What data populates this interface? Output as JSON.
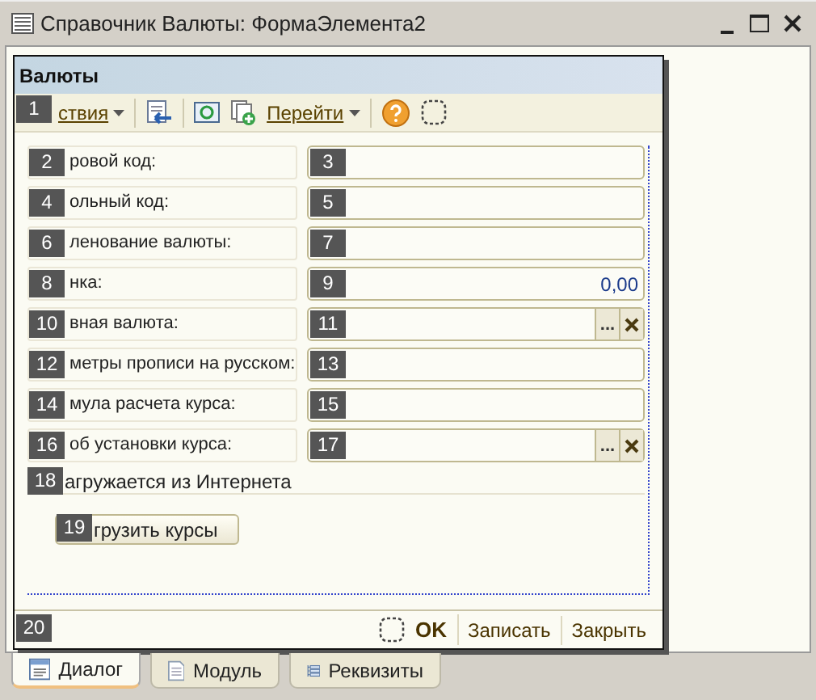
{
  "window": {
    "title": "Справочник Валюты: ФормаЭлемента2"
  },
  "form": {
    "title": "Валюты",
    "toolbar": {
      "badge": "1",
      "actions": "ствия",
      "goto": "Перейти"
    },
    "rows": [
      {
        "kind": "text",
        "label_badge": "2",
        "label": "ровой код:",
        "field_badge": "3"
      },
      {
        "kind": "text",
        "label_badge": "4",
        "label": "ольный код:",
        "field_badge": "5"
      },
      {
        "kind": "text",
        "label_badge": "6",
        "label": "ленование валюты:",
        "field_badge": "7"
      },
      {
        "kind": "number",
        "label_badge": "8",
        "label": "нка:",
        "field_badge": "9",
        "value": "0,00"
      },
      {
        "kind": "choice",
        "label_badge": "10",
        "label": "вная валюта:",
        "field_badge": "11",
        "button": "..."
      },
      {
        "kind": "text",
        "label_badge": "12",
        "label": "метры прописи на русском:",
        "field_badge": "13"
      },
      {
        "kind": "text",
        "label_badge": "14",
        "label": "мула расчета курса:",
        "field_badge": "15"
      },
      {
        "kind": "choice",
        "label_badge": "16",
        "label": "об установки курса:",
        "field_badge": "17",
        "button": "..."
      },
      {
        "kind": "note",
        "label_badge": "18",
        "label": "агружается из Интернета"
      },
      {
        "kind": "button",
        "label_badge": "19",
        "label": "грузить курсы"
      }
    ],
    "footer": {
      "badge": "20",
      "ok": "OK",
      "buttons": [
        "Записать",
        "Закрыть"
      ]
    }
  },
  "tabs": [
    {
      "kind": "dialog",
      "label": "Диалог",
      "selected": true
    },
    {
      "kind": "module",
      "label": "Модуль",
      "selected": false
    },
    {
      "kind": "attributes",
      "label": "Реквизиты",
      "selected": false
    }
  ]
}
